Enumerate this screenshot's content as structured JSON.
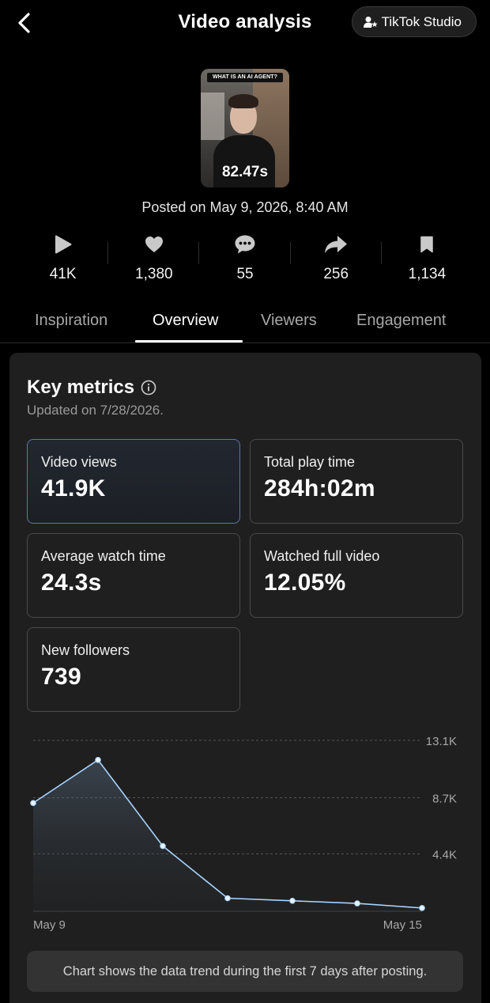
{
  "header": {
    "title": "Video analysis",
    "studio_button_label": "TikTok Studio"
  },
  "video": {
    "thumbnail_banner": "WHAT IS AN AI AGENT?",
    "duration": "82.47s",
    "posted": "Posted on May 9, 2026, 8:40 AM"
  },
  "stats": [
    {
      "icon": "play-icon",
      "value": "41K"
    },
    {
      "icon": "heart-icon",
      "value": "1,380"
    },
    {
      "icon": "comment-icon",
      "value": "55"
    },
    {
      "icon": "share-icon",
      "value": "256"
    },
    {
      "icon": "bookmark-icon",
      "value": "1,134"
    }
  ],
  "tabs": [
    {
      "label": "Inspiration",
      "active": false
    },
    {
      "label": "Overview",
      "active": true
    },
    {
      "label": "Viewers",
      "active": false
    },
    {
      "label": "Engagement",
      "active": false
    }
  ],
  "key_metrics": {
    "title": "Key metrics",
    "updated": "Updated on 7/28/2026.",
    "metrics": [
      {
        "label": "Video views",
        "value": "41.9K",
        "selected": true
      },
      {
        "label": "Total play time",
        "value": "284h:02m",
        "selected": false
      },
      {
        "label": "Average watch time",
        "value": "24.3s",
        "selected": false
      },
      {
        "label": "Watched full video",
        "value": "12.05%",
        "selected": false
      },
      {
        "label": "New followers",
        "value": "739",
        "selected": false
      }
    ]
  },
  "chart_data": {
    "type": "area",
    "x": [
      "May 9",
      "May 10",
      "May 11",
      "May 12",
      "May 13",
      "May 14",
      "May 15"
    ],
    "x_tick_labels": [
      "May 9",
      "May 15"
    ],
    "values": [
      8300,
      11600,
      5000,
      1000,
      800,
      600,
      250
    ],
    "y_ticks": [
      "4.4K",
      "8.7K",
      "13.1K"
    ],
    "y_tick_values": [
      4400,
      8700,
      13100
    ],
    "ylim": [
      0,
      13100
    ],
    "grid": true,
    "line_color": "#a9d4ff"
  },
  "footnote": "Chart shows the data trend during the first 7 days after posting."
}
